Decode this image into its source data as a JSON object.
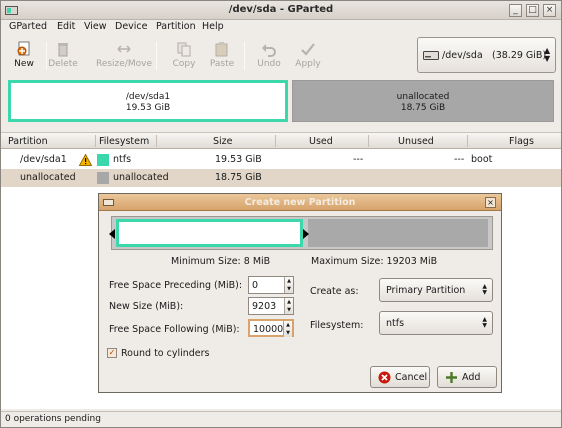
{
  "window": {
    "title": "/dev/sda - GParted"
  },
  "menu": [
    "GParted",
    "Edit",
    "View",
    "Device",
    "Partition",
    "Help"
  ],
  "toolbar": [
    {
      "label": "New",
      "enabled": true,
      "icon": "new-icon"
    },
    {
      "label": "Delete",
      "enabled": false,
      "icon": "delete-icon"
    },
    {
      "label": "Resize/Move",
      "enabled": false,
      "icon": "resize-icon"
    },
    {
      "label": "Copy",
      "enabled": false,
      "icon": "copy-icon"
    },
    {
      "label": "Paste",
      "enabled": false,
      "icon": "paste-icon"
    },
    {
      "label": "Undo",
      "enabled": false,
      "icon": "undo-icon"
    },
    {
      "label": "Apply",
      "enabled": false,
      "icon": "apply-icon"
    }
  ],
  "device": {
    "name": "/dev/sda",
    "size": "(38.29 GiB)"
  },
  "diskmap": [
    {
      "name": "/dev/sda1",
      "size": "19.53 GiB"
    },
    {
      "name": "unallocated",
      "size": "18.75 GiB"
    }
  ],
  "columns": [
    "Partition",
    "Filesystem",
    "Size",
    "Used",
    "Unused",
    "Flags"
  ],
  "rows": [
    {
      "partition": "/dev/sda1",
      "filesystem": "ntfs",
      "size": "19.53 GiB",
      "used": "---",
      "unused": "---",
      "flags": "boot",
      "color": "#3cd8ac",
      "warning": true
    },
    {
      "partition": "unallocated",
      "filesystem": "unallocated",
      "size": "18.75 GiB",
      "used": "",
      "unused": "",
      "flags": "",
      "color": "#a7a7a7",
      "warning": false
    }
  ],
  "status": "0 operations pending",
  "dialog": {
    "title": "Create new Partition",
    "min_size": "Minimum Size: 8 MiB",
    "max_size": "Maximum Size: 19203 MiB",
    "preceding_label": "Free Space Preceding (MiB):",
    "preceding_value": "0",
    "newsize_label": "New Size (MiB):",
    "newsize_value": "9203",
    "following_label": "Free Space Following (MiB):",
    "following_value": "10000",
    "create_as_label": "Create as:",
    "create_as_value": "Primary Partition",
    "filesystem_label": "Filesystem:",
    "filesystem_value": "ntfs",
    "round_label": "Round to cylinders",
    "round_checked": true,
    "cancel_label": "Cancel",
    "add_label": "Add"
  }
}
